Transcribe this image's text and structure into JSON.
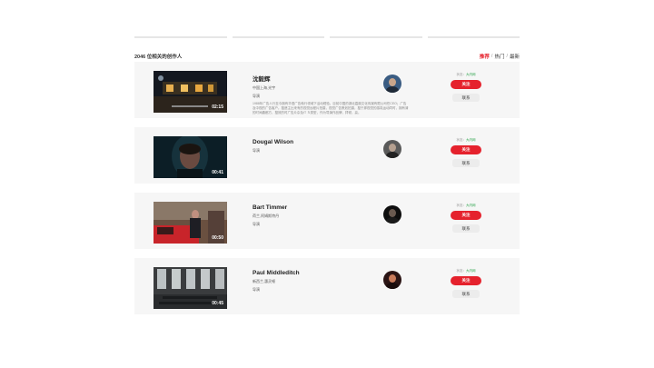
{
  "header": {
    "title": "2046 位相关的创作人",
    "filters": [
      {
        "label": "推荐",
        "active": true
      },
      {
        "label": "热门",
        "active": false
      },
      {
        "label": "最新",
        "active": false
      }
    ],
    "separator": "/"
  },
  "colors": {
    "accent": "#e5222d",
    "status_ok": "#2aa34a",
    "card_bg": "#f6f6f6"
  },
  "creators": [
    {
      "name": "沈毅辉",
      "subtitle": "中国上海,光宇",
      "role": "导演",
      "description": "1988年广告人行至今拥有华语广告執行领域下活动經验。目前中国的湖北嘉鼎文化传媒有限公司任CEO；广告及中视的广告客户。擅遮主比来有的视觉远程片拍摄，视觉广告策划拍摄，擅于那视觉的感真运动同时，拥有清的时间趣都方，擅效的时广告片杂及IT Ｓ类型，作为导演作品牌，拜倾，赢。",
      "duration": "02:15",
      "status_label": "状态：",
      "status_value": "大内网",
      "primary_label": "关注",
      "secondary_label": "联系",
      "thumb_style": "night"
    },
    {
      "name": "Dougal Wilson",
      "subtitle": "",
      "role": "导演",
      "description": "",
      "duration": "00:41",
      "status_label": "状态：",
      "status_value": "大内网",
      "primary_label": "关注",
      "secondary_label": "联系",
      "thumb_style": "hood"
    },
    {
      "name": "Bart Timmer",
      "subtitle": "荷兰,阿姆斯特丹",
      "role": "导演",
      "description": "",
      "duration": "00:50",
      "status_label": "状态：",
      "status_value": "大内网",
      "primary_label": "关注",
      "secondary_label": "联系",
      "thumb_style": "car"
    },
    {
      "name": "Paul Middleditch",
      "subtitle": "新西兰,惠灵顿",
      "role": "导演",
      "description": "",
      "duration": "00:45",
      "status_label": "状态：",
      "status_value": "大内网",
      "primary_label": "关注",
      "secondary_label": "联系",
      "thumb_style": "hall"
    }
  ]
}
